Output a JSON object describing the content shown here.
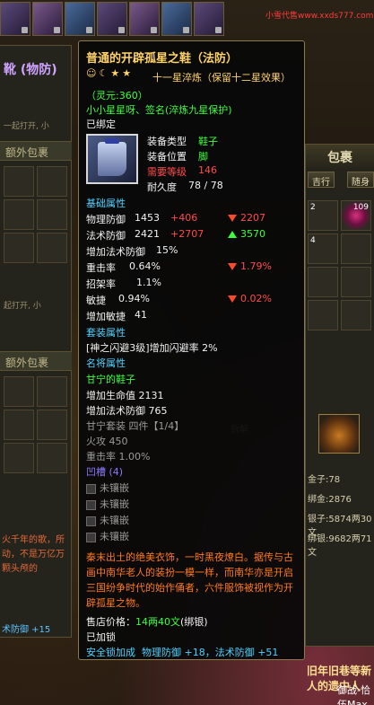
{
  "watermark": "小雪代售www.xxds777.com",
  "left_panel": {
    "title": "靴 (物防)",
    "hint1": "一起打开, 小",
    "section1": "额外包裹",
    "hint2": "起打开, 小",
    "section2": "额外包裹",
    "story": "火千年的歌，所动，不是万亿万颗头颅的",
    "foot": "术防御 +15"
  },
  "right_panel": {
    "header": "包裹",
    "btn_left": "吉行",
    "btn_right": "随身",
    "count_109": "109",
    "num_2": "2",
    "num_4": "4",
    "disassemble": "拆解",
    "gold": "金子:78",
    "bind_silver": "绑金:2876",
    "silver": "银子:5874两30文",
    "bound_silver": "绑银:9682两71文",
    "banner": "旧年旧巷等新人的遗中人",
    "banner2": "御战-恰伍Max"
  },
  "tooltip": {
    "name": "普通的开辟孤星之鞋（法防）",
    "refine": "十一星淬炼（保留十二星效果）",
    "spirit": "（灵元:360）",
    "owner": "小小星星呀、签名(淬炼九星保护)",
    "bound": "已绑定",
    "type_label": "装备类型",
    "type_value": "鞋子",
    "slot_label": "装备位置",
    "slot_value": "脚",
    "level_label": "需要等级",
    "level_value": "146",
    "durability_label": "耐久度",
    "durability_value": "78 / 78",
    "basic_header": "基础属性",
    "stats": [
      {
        "label": "物理防御",
        "value": "1453",
        "bonus": "+406",
        "cmp_dir": "down",
        "cmp": "2207"
      },
      {
        "label": "法术防御",
        "value": "2421",
        "bonus": "+2707",
        "cmp_dir": "up",
        "cmp": "3570"
      },
      {
        "label": "增加法术防御",
        "value": "15%",
        "bonus": "",
        "cmp_dir": "",
        "cmp": ""
      },
      {
        "label": "重击率",
        "value": "0.64%",
        "bonus": "",
        "cmp_dir": "down",
        "cmp": "1.79%"
      },
      {
        "label": "招架率",
        "value": "1.1%",
        "bonus": "",
        "cmp_dir": "",
        "cmp": ""
      },
      {
        "label": "敏捷",
        "value": "0.94%",
        "bonus": "",
        "cmp_dir": "down",
        "cmp": "0.02%"
      },
      {
        "label": "增加敏捷",
        "value": "41",
        "bonus": "",
        "cmp_dir": "",
        "cmp": ""
      }
    ],
    "set_header": "套装属性",
    "set_line": "[神之闪避3级]增加闪避率 2%",
    "general_header": "名将属性",
    "general_name": "甘宁的鞋子",
    "general_hp": "增加生命值 2131",
    "general_mdef": "增加法术防御 765",
    "set_suit": "甘宁套装  四件【1/4】",
    "fire_attack": "火攻 450",
    "crit": "重击率 1.00%",
    "sockets_header": "凹槽 (4)",
    "socket_label": "未镶嵌",
    "description": "秦末出土的绝美衣饰，一时黑夜燎白。据传与古画中南华老人的装扮一模一样，而南华亦是开启三国纷争时代的始作俑者，六件服饰被视作为开辟孤星之物。",
    "price_label": "售店价格：",
    "price_value": "14两40文",
    "price_note": "(绑银)",
    "locked": "已加锁",
    "security": "安全锁加成",
    "security_bonus": "物理防御 +18，法术防御 +51"
  }
}
